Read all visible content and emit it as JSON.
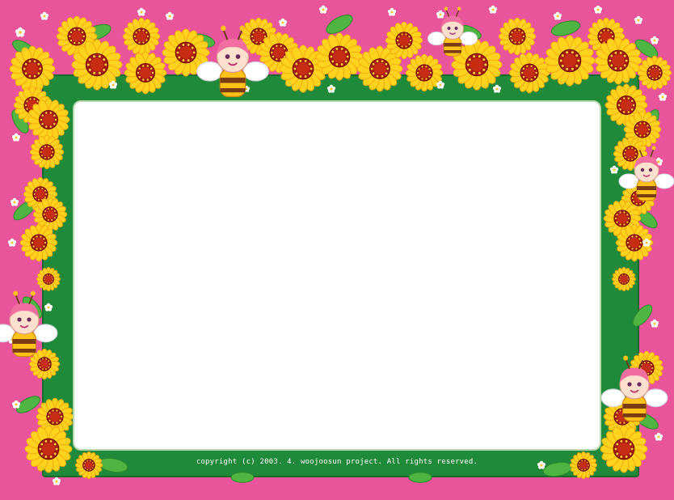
{
  "colors": {
    "background": "#e8559a",
    "frame": "#1f8b3a",
    "panel": "#ffffff",
    "petal": "#ffd21e",
    "petal_edge": "#f3a10a",
    "center": "#a31b0c",
    "leaf": "#4fb542",
    "daisy": "#ffffff"
  },
  "footer": {
    "copyright": "copyright (c) 2003. 4. woojoosun project. All rights reserved."
  },
  "decorations": {
    "flower": "sunflower-icon",
    "small_flower": "daisy-icon",
    "character": "bee-fairy-icon"
  }
}
